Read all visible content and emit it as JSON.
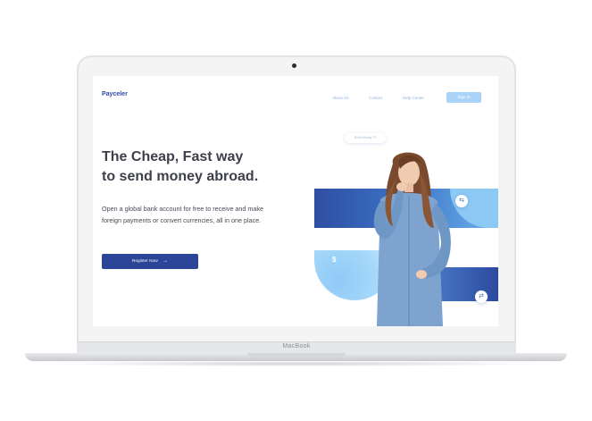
{
  "device": {
    "chin_label": "MacBook"
  },
  "site": {
    "logo": "Payceler",
    "nav": {
      "about": "About Us",
      "contact": "Contact",
      "help": "Help Center",
      "signin": "Sign In"
    },
    "headline_line1": "The Cheap, Fast way",
    "headline_line2": "to send money abroad.",
    "subtext": "Open a global bank account for free to receive and make foreign payments or convert currencies, all in one place.",
    "register_label": "Register Now",
    "chip_label": "Send Money ??"
  },
  "colors": {
    "brand": "#3046a8",
    "button": "#2c4598",
    "accent_light": "#a9d3f7"
  },
  "icons": {
    "register_arrow": "arrow-right-icon",
    "coin_top": "currency-exchange-icon",
    "coin_dollar": "dollar-icon",
    "coin_bottom": "transfer-icon"
  }
}
